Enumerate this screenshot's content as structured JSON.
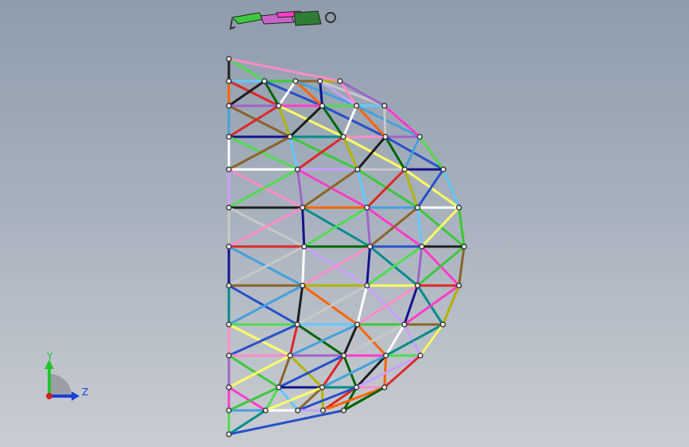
{
  "view": {
    "background_top": "#8e9cab",
    "background_bottom": "#c9cdd2"
  },
  "model": {
    "description_icon": "geodesic-dome-wireframe",
    "strut_palette": [
      "#ff3cc8",
      "#3cc83c",
      "#ffff64",
      "#2850c8",
      "#46a0dc",
      "#c8c8c8",
      "#ff8cc8",
      "#50dc50",
      "#8c6428",
      "#dc2828",
      "#1e1e1e",
      "#ffffff",
      "#14148c",
      "#a064c8",
      "#64c8ff",
      "#b4b400",
      "#006400",
      "#ff6400",
      "#c8a0ff",
      "#008c8c"
    ]
  },
  "triad": {
    "y_label": "Y",
    "z_label": "Z",
    "y_color": "#22c22e",
    "z_color": "#1f3fd6",
    "x_color": "#d52020"
  },
  "mini_part": {
    "icon": "floating-part-icon"
  }
}
